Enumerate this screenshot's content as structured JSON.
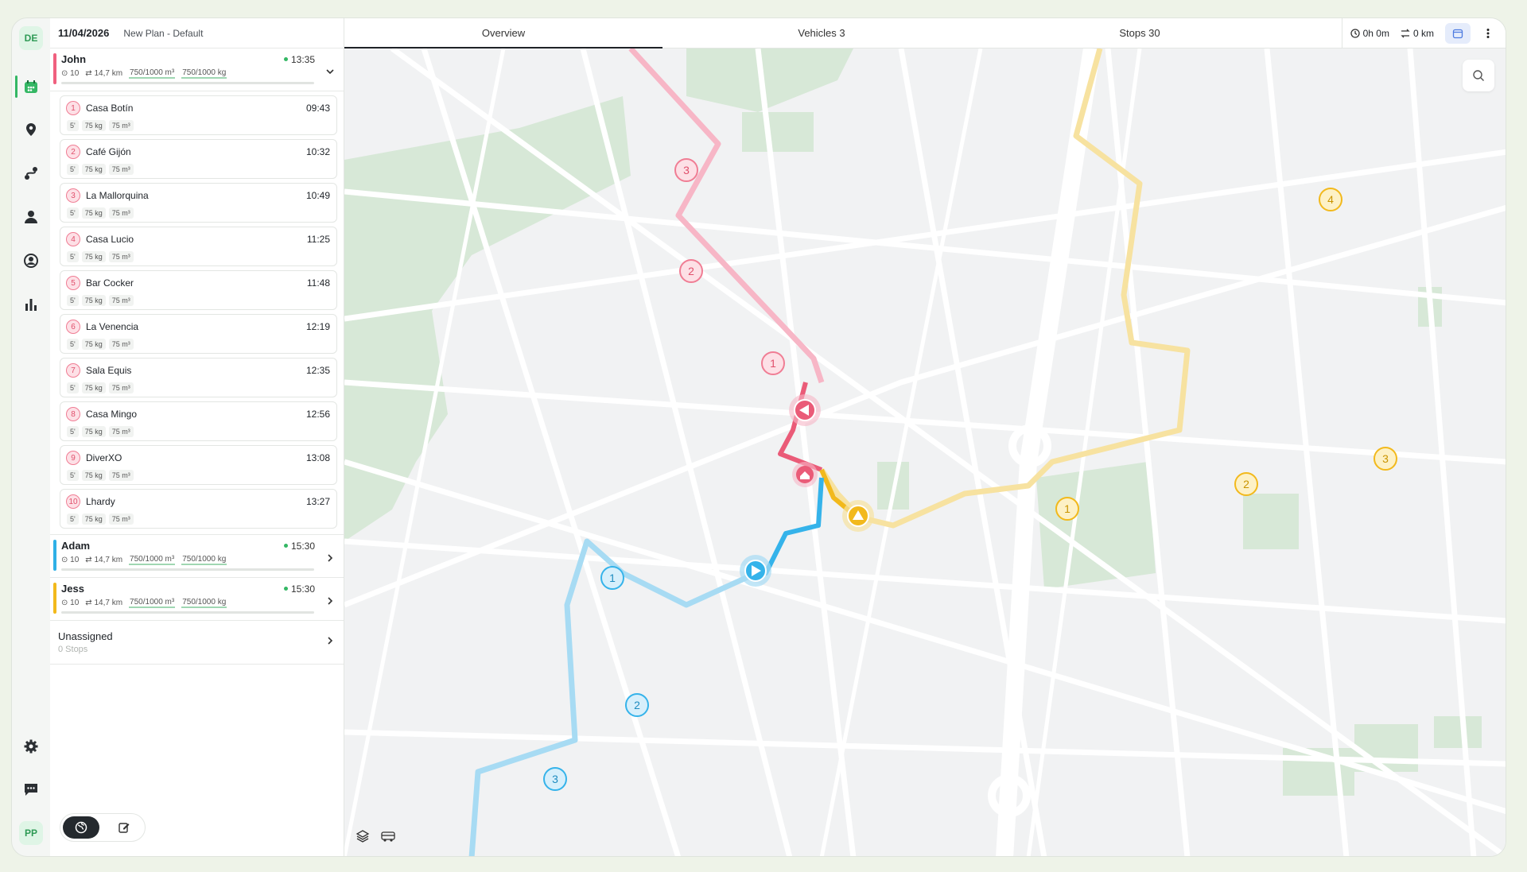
{
  "rail": {
    "top_badge": "DE",
    "bottom_badge": "PP",
    "icons": [
      "calendar-icon",
      "location-pin-icon",
      "route-icon",
      "driver-icon",
      "user-circle-icon",
      "bar-chart-icon",
      "gear-icon",
      "chat-icon"
    ]
  },
  "header": {
    "date": "11/04/2026",
    "plan_name": "New Plan - Default"
  },
  "tabs": [
    {
      "label": "Overview",
      "active": true
    },
    {
      "label": "Vehicles 3",
      "active": false
    },
    {
      "label": "Stops 30",
      "active": false
    }
  ],
  "toolbar": {
    "duration": "0h 0m",
    "distance": "0 km"
  },
  "routes": [
    {
      "name": "John",
      "color": "#f0607f",
      "end_time": "13:35",
      "stops_count": "10",
      "distance": "14,7 km",
      "volume": "750/1000 m³",
      "weight": "750/1000 kg",
      "expanded": true,
      "stops": [
        {
          "num": "1",
          "name": "Casa Botín",
          "time": "09:43",
          "duration": "5'",
          "weight": "75 kg",
          "volume": "75 m³"
        },
        {
          "num": "2",
          "name": "Café Gijón",
          "time": "10:32",
          "duration": "5'",
          "weight": "75 kg",
          "volume": "75 m³"
        },
        {
          "num": "3",
          "name": "La Mallorquina",
          "time": "10:49",
          "duration": "5'",
          "weight": "75 kg",
          "volume": "75 m³"
        },
        {
          "num": "4",
          "name": "Casa Lucio",
          "time": "11:25",
          "duration": "5'",
          "weight": "75 kg",
          "volume": "75 m³"
        },
        {
          "num": "5",
          "name": "Bar Cocker",
          "time": "11:48",
          "duration": "5'",
          "weight": "75 kg",
          "volume": "75 m³"
        },
        {
          "num": "6",
          "name": "La Venencia",
          "time": "12:19",
          "duration": "5'",
          "weight": "75 kg",
          "volume": "75 m³"
        },
        {
          "num": "7",
          "name": "Sala Equis",
          "time": "12:35",
          "duration": "5'",
          "weight": "75 kg",
          "volume": "75 m³"
        },
        {
          "num": "8",
          "name": "Casa Mingo",
          "time": "12:56",
          "duration": "5'",
          "weight": "75 kg",
          "volume": "75 m³"
        },
        {
          "num": "9",
          "name": "DiverXO",
          "time": "13:08",
          "duration": "5'",
          "weight": "75 kg",
          "volume": "75 m³"
        },
        {
          "num": "10",
          "name": "Lhardy",
          "time": "13:27",
          "duration": "5'",
          "weight": "75 kg",
          "volume": "75 m³"
        }
      ]
    },
    {
      "name": "Adam",
      "color": "#2fb0e6",
      "end_time": "15:30",
      "stops_count": "10",
      "distance": "14,7 km",
      "volume": "750/1000 m³",
      "weight": "750/1000 kg",
      "expanded": false
    },
    {
      "name": "Jess",
      "color": "#f2b91c",
      "end_time": "15:30",
      "stops_count": "10",
      "distance": "14,7 km",
      "volume": "750/1000 m³",
      "weight": "750/1000 kg",
      "expanded": false
    }
  ],
  "unassigned": {
    "title": "Unassigned",
    "subtitle": "0 Stops"
  },
  "map": {
    "markers": {
      "pink": [
        "1",
        "2",
        "3"
      ],
      "blue": [
        "1",
        "2",
        "3"
      ],
      "yellow": [
        "1",
        "2",
        "3",
        "4"
      ]
    },
    "colors": {
      "pink": "#f7b6c6",
      "pink_dark": "#ea5b78",
      "blue": "#a7dbf3",
      "blue_dark": "#35b3ea",
      "yellow": "#f7e2a0",
      "yellow_dark": "#f2b91c",
      "park": "#d7e8d7"
    }
  }
}
